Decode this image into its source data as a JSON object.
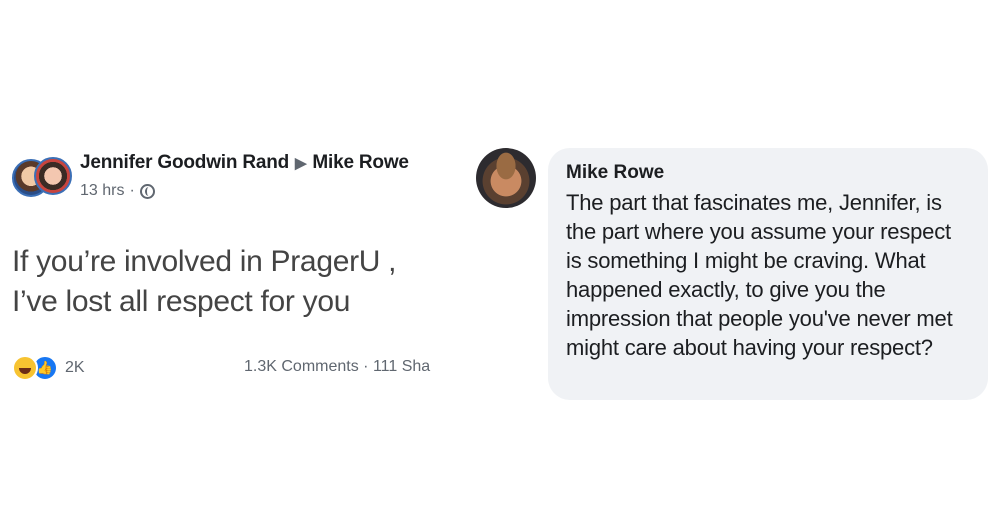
{
  "post": {
    "author": "Jennifer Goodwin Rand",
    "target": "Mike Rowe",
    "time": "13 hrs",
    "separator": "·",
    "text_line1": "If you’re involved in PragerU ,",
    "text_line2": "I’ve lost all respect for you",
    "reaction_icons": [
      "haha-icon",
      "like-icon"
    ],
    "reaction_count": "2K",
    "comments": "1.3K Comments",
    "shares": "111 Sha"
  },
  "comment": {
    "author": "Mike Rowe",
    "text": "The part that fascinates me, Jennifer, is the part where you assume your respect is something I might be craving. What happened exactly, to give you the impression that people you've never met might care about having your respect?"
  },
  "colors": {
    "bubble": "#f0f2f5",
    "meta": "#606770",
    "like_blue": "#1877f2",
    "haha_yellow": "#f7c331"
  }
}
